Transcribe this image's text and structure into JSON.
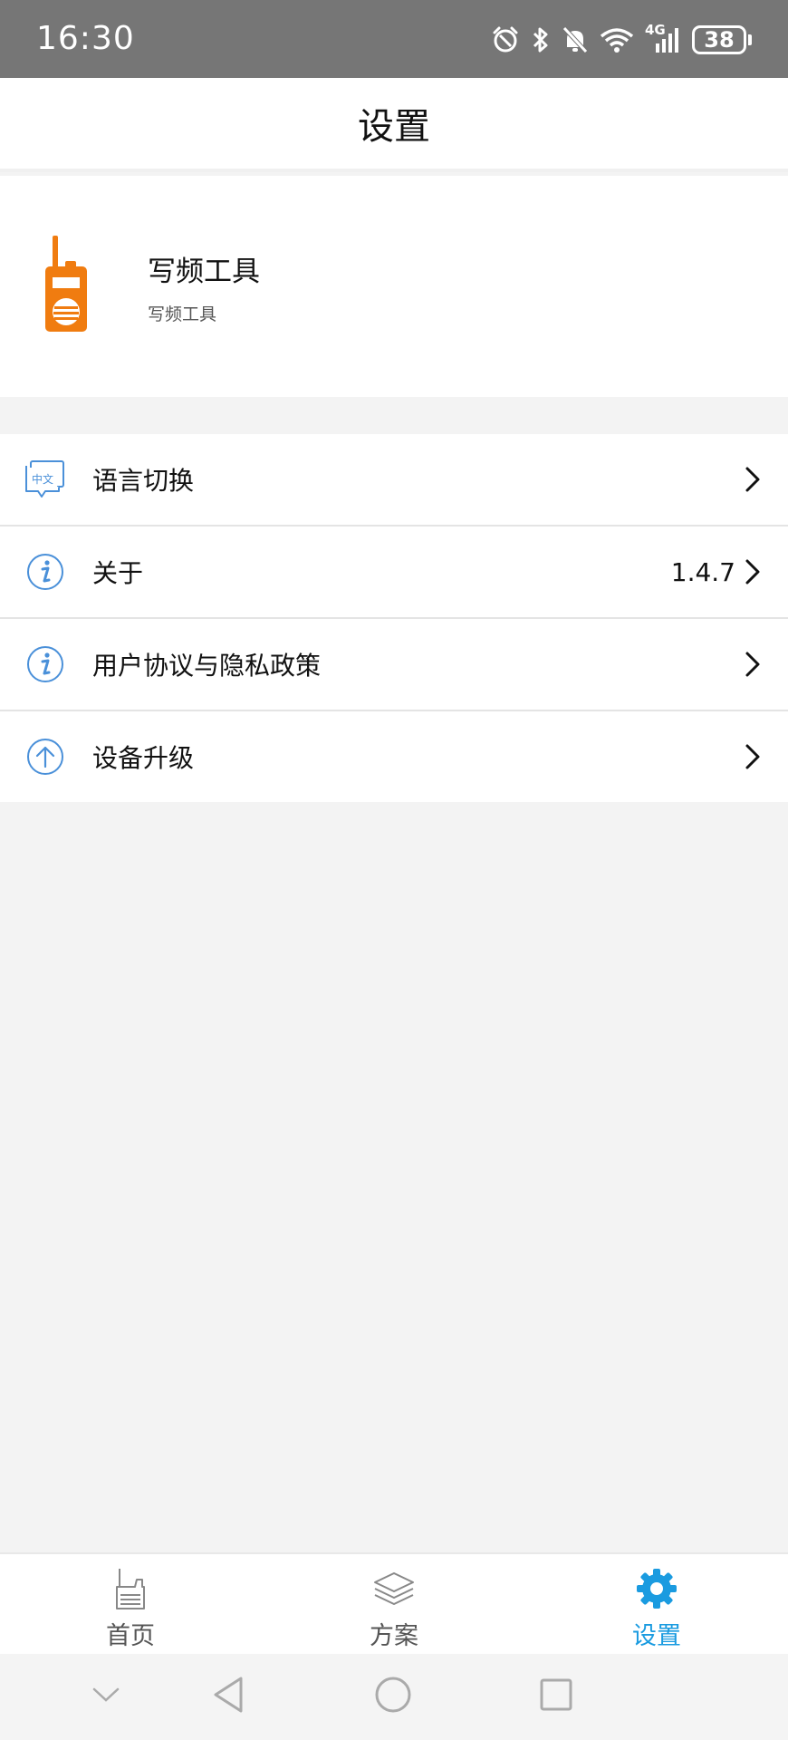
{
  "status_bar": {
    "time": "16:30",
    "network": "4G",
    "battery": "38",
    "icons": [
      "alarm-icon",
      "bluetooth-icon",
      "mute-icon",
      "wifi-icon",
      "signal-icon",
      "battery-icon"
    ]
  },
  "header": {
    "title": "设置"
  },
  "app_info": {
    "name": "写频工具",
    "subtitle": "写频工具",
    "logo": "walkie-talkie-icon"
  },
  "settings": {
    "items": [
      {
        "label": "语言切换",
        "icon": "language-icon",
        "value": ""
      },
      {
        "label": "关于",
        "icon": "info-icon",
        "value": "1.4.7"
      },
      {
        "label": "用户协议与隐私政策",
        "icon": "info-icon",
        "value": ""
      },
      {
        "label": "设备升级",
        "icon": "upgrade-icon",
        "value": ""
      }
    ],
    "language_icon_text": "中文"
  },
  "bottom_nav": {
    "items": [
      {
        "label": "首页",
        "icon": "radio-icon",
        "active": false
      },
      {
        "label": "方案",
        "icon": "layers-icon",
        "active": false
      },
      {
        "label": "设置",
        "icon": "gear-icon",
        "active": true
      }
    ]
  },
  "colors": {
    "accent": "#1a9be0",
    "logo": "#f07c10",
    "icon_blue": "#4a90d9",
    "status_bar": "#767676",
    "background": "#f3f3f3"
  }
}
